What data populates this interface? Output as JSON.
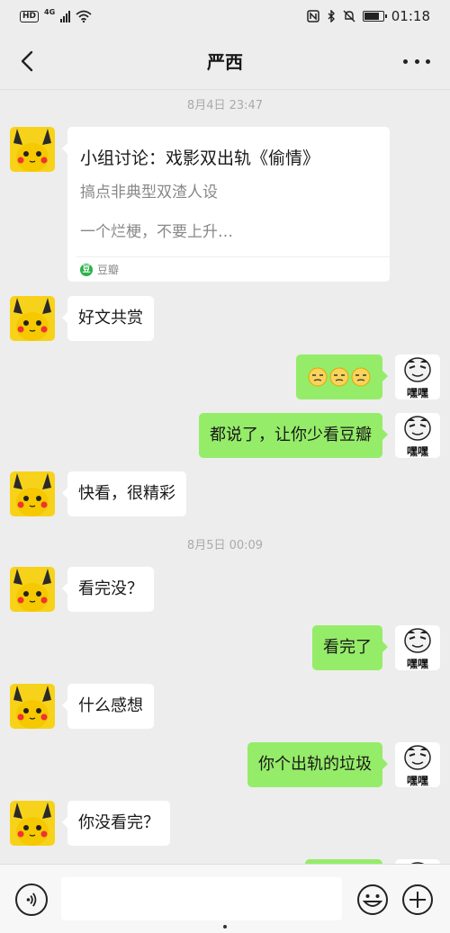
{
  "status_bar": {
    "hd": "HD",
    "network": "4G",
    "time": "01:18",
    "icons": [
      "nfc-icon",
      "bluetooth-icon",
      "mute-icon",
      "battery-icon"
    ]
  },
  "header": {
    "title": "严西"
  },
  "timestamps": [
    "8月4日 23:47",
    "8月5日 00:09"
  ],
  "card": {
    "title": "小组讨论：戏影双出轨《偷情》",
    "subtitle": "搞点非典型双渣人设",
    "description": "一个烂梗，不要上升…",
    "source": "豆瓣",
    "source_icon_letter": "豆"
  },
  "messages": [
    {
      "side": "left",
      "text": "好文共赏"
    },
    {
      "side": "right",
      "text": "",
      "emojis": [
        "smirk-emoji",
        "smirk-emoji",
        "smirk-emoji"
      ]
    },
    {
      "side": "right",
      "text": "都说了，让你少看豆瓣"
    },
    {
      "side": "left",
      "text": "快看，很精彩"
    },
    {
      "side": "left",
      "text": "看完没？"
    },
    {
      "side": "right",
      "text": "看完了"
    },
    {
      "side": "left",
      "text": "什么感想"
    },
    {
      "side": "right",
      "text": "你个出轨的垃圾"
    },
    {
      "side": "left",
      "text": "你没看完？"
    }
  ],
  "avatars": {
    "self_caption": "嘿嘿"
  },
  "input": {
    "placeholder": ""
  },
  "colors": {
    "background": "#ededed",
    "sent_bubble": "#95ec69",
    "received_bubble": "#ffffff",
    "douban_green": "#2bb24c"
  }
}
